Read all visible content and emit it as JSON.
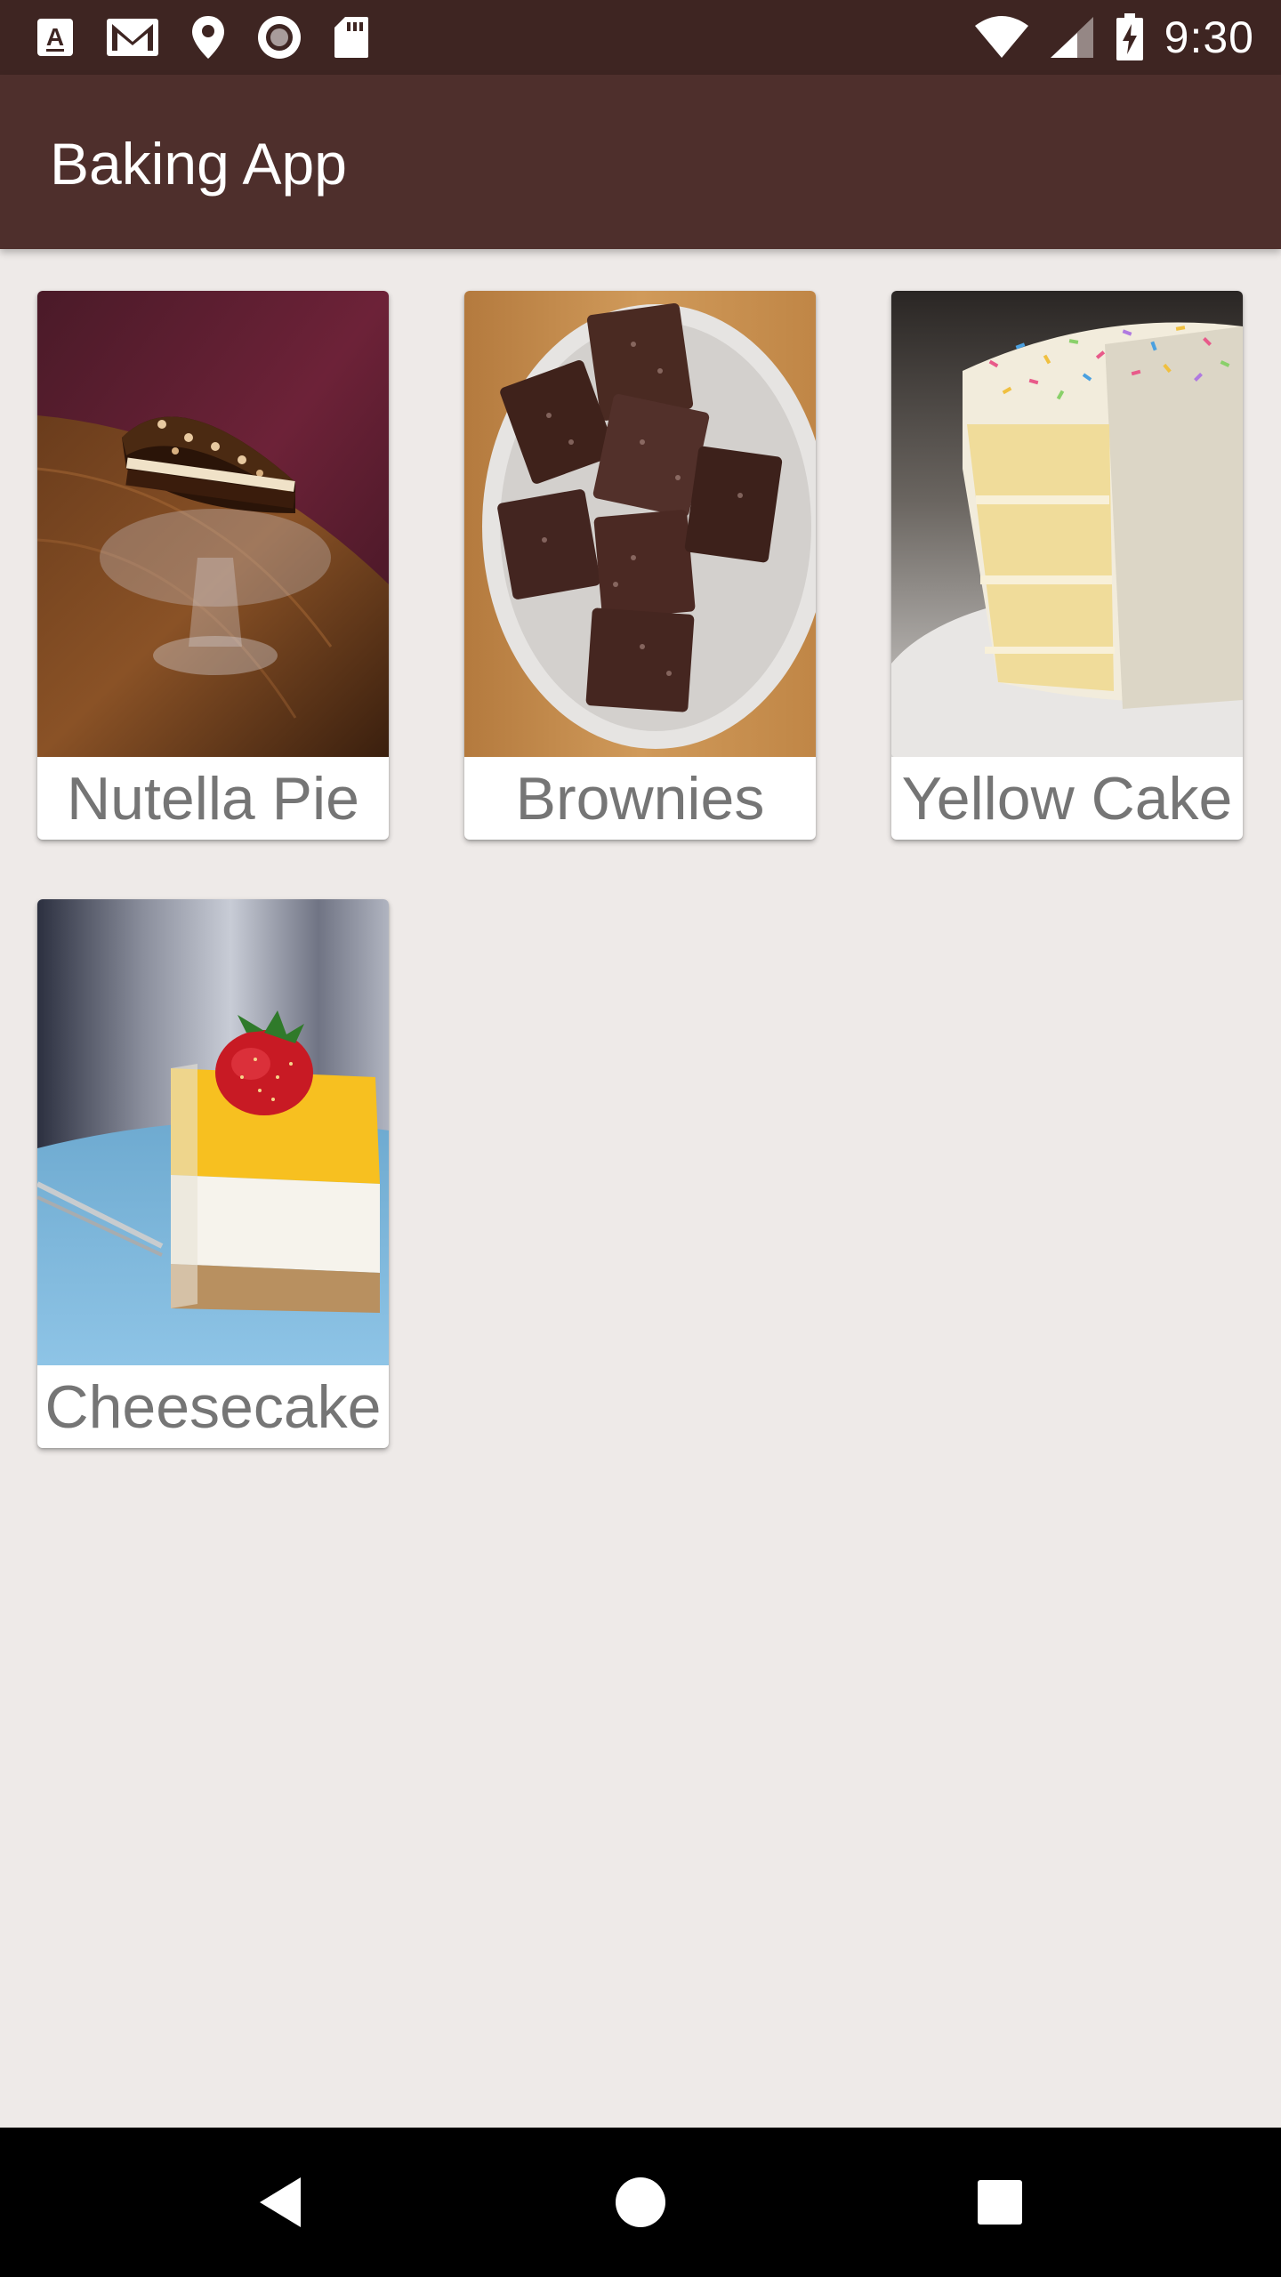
{
  "status_bar": {
    "time": "9:30",
    "left_icons": [
      "font-download-icon",
      "gmail-icon",
      "location-pin-icon",
      "record-icon",
      "sd-card-icon"
    ],
    "right_icons": [
      "wifi-icon",
      "cell-signal-icon",
      "battery-charging-icon"
    ]
  },
  "app_bar": {
    "title": "Baking App"
  },
  "recipes": [
    {
      "name": "Nutella Pie"
    },
    {
      "name": "Brownies"
    },
    {
      "name": "Yellow Cake"
    },
    {
      "name": "Cheesecake"
    }
  ],
  "nav_bar": {
    "icons": [
      "back-icon",
      "home-icon",
      "recents-icon"
    ]
  },
  "colors": {
    "status_bar": "#3e2522",
    "app_bar": "#4e2f2c",
    "background": "#eeeae8",
    "card": "#ffffff",
    "recipe_text": "#757575",
    "nav_bar": "#000000"
  }
}
